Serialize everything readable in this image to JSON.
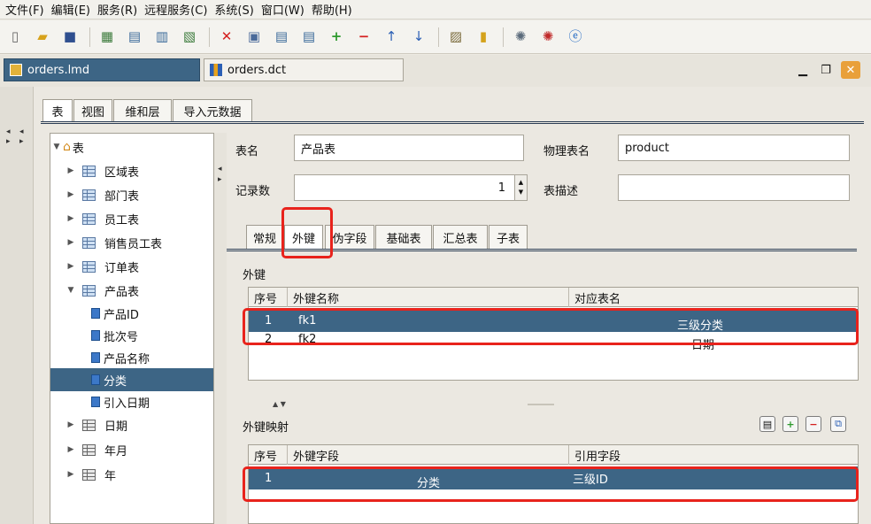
{
  "menu": [
    "文件(F)",
    "编辑(E)",
    "服务(R)",
    "远程服务(C)",
    "系统(S)",
    "窗口(W)",
    "帮助(H)"
  ],
  "doc_tabs": {
    "lmd": "orders.lmd",
    "dct": "orders.dct"
  },
  "panel_tabs": [
    "表",
    "视图",
    "维和层",
    "导入元数据"
  ],
  "tree": {
    "root": "表",
    "items": [
      "区域表",
      "部门表",
      "员工表",
      "销售员工表",
      "订单表",
      "产品表"
    ],
    "fields": [
      "产品ID",
      "批次号",
      "产品名称",
      "分类",
      "引入日期"
    ],
    "tail": [
      "日期",
      "年月",
      "年"
    ]
  },
  "form": {
    "table_name_label": "表名",
    "table_name": "产品表",
    "physical_name_label": "物理表名",
    "physical_name": "product",
    "record_count_label": "记录数",
    "record_count": "1",
    "desc_label": "表描述",
    "desc": ""
  },
  "sub_tabs": [
    "常规",
    "外键",
    "伪字段",
    "基础表",
    "汇总表",
    "子表"
  ],
  "fk_section": {
    "title": "外键",
    "headers": [
      "序号",
      "外键名称",
      "对应表名"
    ],
    "rows": [
      {
        "no": "1",
        "name": "fk1",
        "table": "三级分类"
      },
      {
        "no": "2",
        "name": "fk2",
        "table": "日期"
      }
    ]
  },
  "map_section": {
    "title": "外键映射",
    "headers": [
      "序号",
      "外键字段",
      "引用字段"
    ],
    "rows": [
      {
        "no": "1",
        "field": "分类",
        "ref": "三级ID"
      }
    ]
  },
  "colors": {
    "selection": "#3d6585",
    "highlight": "#e8231c"
  }
}
